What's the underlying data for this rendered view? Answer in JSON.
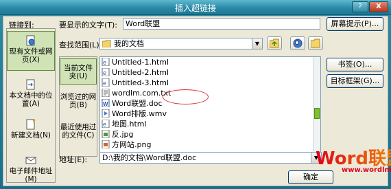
{
  "window": {
    "title": "插入超链接",
    "help_glyph": "?",
    "close_glyph": "X"
  },
  "link_to_label": "链接到:",
  "left_nav": [
    {
      "label": "现有文件或网页(X)",
      "icon": "file-web-icon",
      "selected": true
    },
    {
      "label": "本文档中的位置(A)",
      "icon": "bookmark-place-icon",
      "selected": false
    },
    {
      "label": "新建文档(N)",
      "icon": "new-document-icon",
      "selected": false
    },
    {
      "label": "电子邮件地址(M)",
      "icon": "email-icon",
      "selected": false
    }
  ],
  "display_text": {
    "label": "要显示的文字(T):",
    "value": "Word联盟"
  },
  "screen_tip_button": "屏幕提示(P)...",
  "look_in": {
    "label": "查找范围(L):",
    "value": "我的文档"
  },
  "sub_nav": [
    {
      "label": "当前文件夹(U)",
      "selected": true
    },
    {
      "label": "浏览过的网页(B)",
      "selected": false
    },
    {
      "label": "最近使用过的文件(C)",
      "selected": false
    }
  ],
  "files": [
    {
      "name": "Untitled-1.html",
      "icon": "html-file-icon"
    },
    {
      "name": "Untitled-2.html",
      "icon": "html-file-icon"
    },
    {
      "name": "Untitled-3.html",
      "icon": "html-file-icon"
    },
    {
      "name": "wordlm.com.txt",
      "icon": "text-file-icon"
    },
    {
      "name": "Word联盟.doc",
      "icon": "word-doc-icon"
    },
    {
      "name": "Word排版.wmv",
      "icon": "video-file-icon"
    },
    {
      "name": "地图.html",
      "icon": "html-file-icon"
    },
    {
      "name": "反.jpg",
      "icon": "image-file-icon"
    },
    {
      "name": "方网站.png",
      "icon": "image-file-icon"
    }
  ],
  "right_buttons": {
    "bookmark": "书签(O)...",
    "target_frame": "目标框架(G)..."
  },
  "address": {
    "label": "地址(E):",
    "value": "D:\\我的文档\\Word联盟.doc"
  },
  "ok_button": "确定",
  "watermark": {
    "brand": "Word联盟",
    "url": "www.wordlm.com"
  }
}
